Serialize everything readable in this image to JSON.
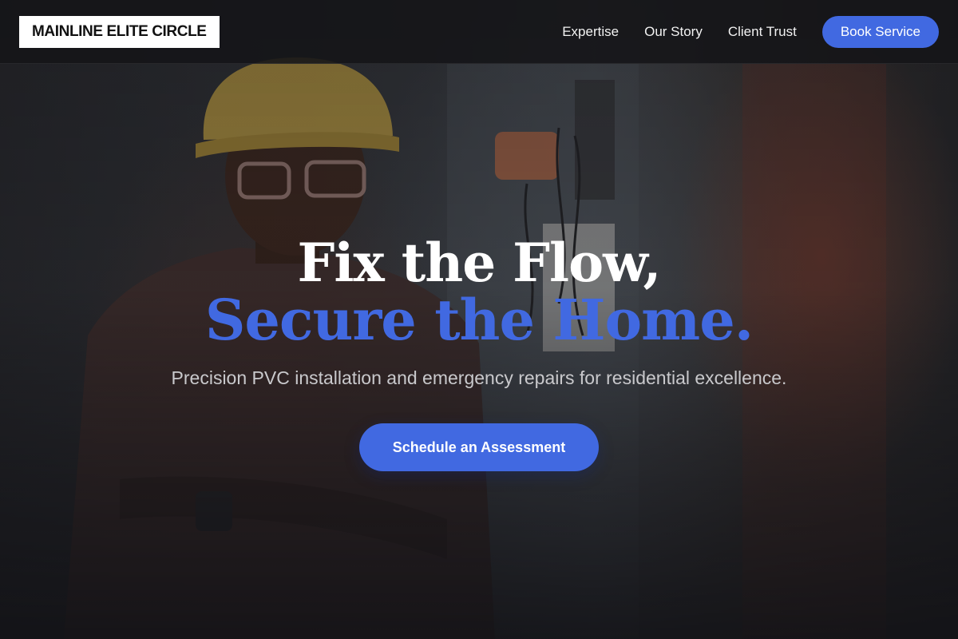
{
  "brand": {
    "name": "MAINLINE ELITE CIRCLE"
  },
  "nav": {
    "items": [
      {
        "label": "Expertise"
      },
      {
        "label": "Our Story"
      },
      {
        "label": "Client Trust"
      }
    ],
    "cta_label": "Book Service"
  },
  "hero": {
    "headline_line1": "Fix the Flow,",
    "headline_line2": "Secure the Home.",
    "subtitle": "Precision PVC installation and emergency repairs for residential excellence.",
    "cta_label": "Schedule an Assessment",
    "background_image": "electrician-in-hard-hat-photo"
  },
  "colors": {
    "accent": "#4169e1",
    "navbar_bg": "#141418",
    "logo_bg": "#ffffff",
    "headline_primary": "#ffffff",
    "subtitle": "#c9c9cc"
  }
}
